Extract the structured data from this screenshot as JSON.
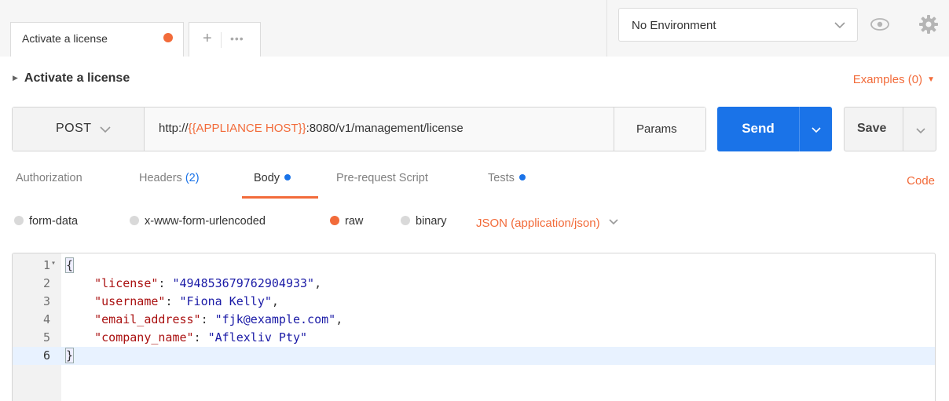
{
  "tabs": {
    "active_tab_label": "Activate a license",
    "add_tab_label": "+",
    "more_label": "•••"
  },
  "environment": {
    "selected": "No Environment"
  },
  "request": {
    "name": "Activate a license",
    "examples_label": "Examples (0)",
    "method": "POST",
    "url_prefix": "http://",
    "url_variable": "{{APPLIANCE HOST}}",
    "url_suffix": ":8080/v1/management/license",
    "params_label": "Params",
    "send_label": "Send",
    "save_label": "Save"
  },
  "subtabs": {
    "authorization": "Authorization",
    "headers": "Headers",
    "headers_count": "(2)",
    "body": "Body",
    "prerequest": "Pre-request Script",
    "tests": "Tests",
    "code_link": "Code"
  },
  "body_modes": {
    "form_data": "form-data",
    "urlencoded": "x-www-form-urlencoded",
    "raw": "raw",
    "binary": "binary",
    "content_type": "JSON (application/json)",
    "selected": "raw"
  },
  "editor": {
    "lines": [
      {
        "num": "1",
        "text": "{"
      },
      {
        "num": "2",
        "key": "\"license\"",
        "value": "\"494853679762904933\"",
        "trail": ","
      },
      {
        "num": "3",
        "key": "\"username\"",
        "value": "\"Fiona Kelly\"",
        "trail": ","
      },
      {
        "num": "4",
        "key": "\"email_address\"",
        "value": "\"fjk@example.com\"",
        "trail": ","
      },
      {
        "num": "5",
        "key": "\"company_name\"",
        "value": "\"Aflexliv Pty\"",
        "trail": ""
      },
      {
        "num": "6",
        "text": "}"
      }
    ],
    "active_line": 6
  },
  "colors": {
    "accent_orange": "#f26b3a",
    "primary_blue": "#1a73e8"
  },
  "icons": {
    "env_dropdown": "chevron-down-icon",
    "quick_look": "eye-icon",
    "settings": "gear-icon",
    "collapse": "triangle-right-icon"
  }
}
